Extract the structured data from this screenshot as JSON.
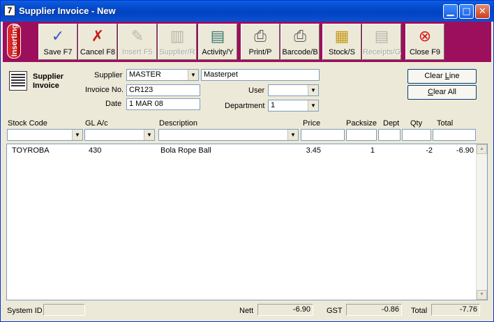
{
  "window": {
    "title": "Supplier Invoice - New",
    "app_icon": "7"
  },
  "toolbar": {
    "status_label": "Inserting",
    "buttons": [
      {
        "label": "Save F7",
        "icon": "checkmark-icon",
        "enabled": true
      },
      {
        "label": "Cancel F8",
        "icon": "cross-icon",
        "enabled": true
      },
      {
        "label": "Insert F5",
        "icon": "pencil-icon",
        "enabled": false
      },
      {
        "label": "Supplier/R",
        "icon": "supplier-icon",
        "enabled": false
      },
      {
        "label": "Activity/Y",
        "icon": "activity-icon",
        "enabled": true
      },
      {
        "label": "Print/P",
        "icon": "printer-icon",
        "enabled": true
      },
      {
        "label": "Barcode/B",
        "icon": "barcode-printer-icon",
        "enabled": true
      },
      {
        "label": "Stock/S",
        "icon": "stock-icon",
        "enabled": true
      },
      {
        "label": "Receipts/G",
        "icon": "receipts-icon",
        "enabled": false
      },
      {
        "label": "Close F9",
        "icon": "close-circle-icon",
        "enabled": true
      }
    ]
  },
  "header": {
    "heading_line1": "Supplier",
    "heading_line2": "Invoice",
    "supplier_label": "Supplier",
    "supplier_code": "MASTER",
    "supplier_name": "Masterpet",
    "invoice_label": "Invoice No.",
    "invoice_no": "CR123",
    "date_label": "Date",
    "date": "1 MAR 08",
    "user_label": "User",
    "user": "",
    "department_label": "Department",
    "department": "1",
    "clear_line": "Clear Line",
    "clear_line_hotkey": "L",
    "clear_all": "Clear All",
    "clear_all_hotkey": "C"
  },
  "columns": {
    "stock_code": "Stock Code",
    "gl_ac": "GL A/c",
    "description": "Description",
    "price": "Price",
    "packsize": "Packsize",
    "dept": "Dept",
    "qty": "Qty",
    "total": "Total"
  },
  "lines": [
    {
      "stock_code": "TOYROBA",
      "gl_ac": "430",
      "description": "Bola Rope Ball",
      "price": "3.45",
      "packsize": "1",
      "dept": "",
      "qty": "-2",
      "total": "-6.90"
    }
  ],
  "footer": {
    "system_id_label": "System ID",
    "system_id": "",
    "nett_label": "Nett",
    "nett": "-6.90",
    "gst_label": "GST",
    "gst": "-0.86",
    "total_label": "Total",
    "total": "-7.76"
  }
}
